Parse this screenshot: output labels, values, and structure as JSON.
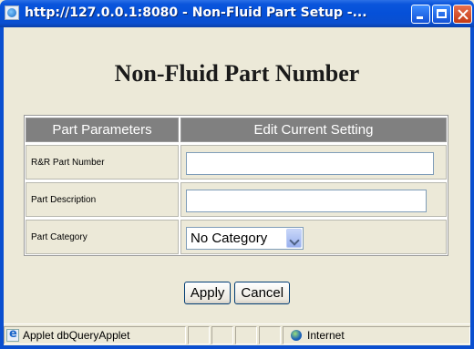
{
  "window": {
    "title": "http://127.0.0.1:8080 - Non-Fluid Part Setup -..."
  },
  "page": {
    "title": "Non-Fluid Part Number"
  },
  "table": {
    "header_params": "Part Parameters",
    "header_setting": "Edit Current Setting",
    "rows": [
      {
        "label": "R&R Part Number",
        "value": ""
      },
      {
        "label": "Part Description",
        "value": ""
      },
      {
        "label": "Part Category",
        "value": "No Category"
      }
    ]
  },
  "buttons": {
    "apply": "Apply",
    "cancel": "Cancel"
  },
  "status": {
    "left": "Applet dbQueryApplet",
    "zone": "Internet"
  },
  "colors": {
    "titlebar": "#0a55dc",
    "table_header": "#808080",
    "background": "#ece9d8"
  }
}
